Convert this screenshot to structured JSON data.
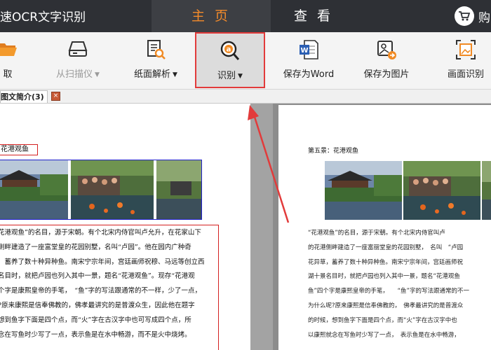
{
  "titlebar": {
    "app_title": "速OCR文字识别",
    "tabs": [
      {
        "label": "主 页",
        "active": true
      },
      {
        "label": "查 看",
        "active": false
      }
    ],
    "buy_label": "购"
  },
  "toolbar": {
    "items": [
      {
        "label": "取",
        "icon": "folder-open-icon",
        "has_dropdown": false,
        "enabled": true
      },
      {
        "label": "从扫描仪",
        "icon": "scanner-icon",
        "has_dropdown": true,
        "enabled": false
      },
      {
        "label": "纸面解析",
        "icon": "document-search-icon",
        "has_dropdown": true,
        "enabled": true
      },
      {
        "label": "识别",
        "icon": "ocr-magnifier-icon",
        "has_dropdown": true,
        "enabled": true,
        "highlighted": true
      },
      {
        "label": "保存为Word",
        "icon": "word-file-icon",
        "has_dropdown": false,
        "enabled": true
      },
      {
        "label": "保存为图片",
        "icon": "save-image-icon",
        "has_dropdown": false,
        "enabled": true
      },
      {
        "label": "画面识别",
        "icon": "screen-capture-icon",
        "has_dropdown": false,
        "enabled": true
      }
    ],
    "dropdown_glyph": "▼"
  },
  "doc_tab": {
    "label": "图文简介(3)",
    "close": "×"
  },
  "left_page": {
    "heading": "花港观鱼",
    "lines": [
      "花港观鱼”的名目，源于宋朝。有个北宋内侍官叫卢允升，在花家山下",
      "侧畔建造了一座富堂皇的花园别墅，名叫“卢园”。他在园内广种奇",
      "　蓄养了数十种异种鱼。南宋宁宗年间，宫廷画师祝穆、马远等创立西",
      "名目时，就把卢园也列入其中一景，题名“花港观鱼”。现存“花港观",
      "个字是康熙皇帝的手笔，　“鱼”字的写法跟通常的不一样，少了一点，",
      "?原来康熙是信奉佛教的，佛孝最讲究的是普渡众生，因此他在题字",
      "想到鱼字下面是四个点，而“火”字在古汉字中也可写成四个点，所",
      "念在写鱼时少写了一点，表示鱼是在水中畅游，而不是火中烧烤。"
    ]
  },
  "right_page": {
    "heading": "第五景：花港观鱼",
    "lines": [
      "“花港观鱼”的名目，源于宋朝。有个北宋内侍官叫卢",
      "的花港侧畔建造了一座富丽堂皇的花园别墅，　名叫　“卢园",
      "花异草，蓄养了数十种异种鱼。南宋宁宗年间，宫廷画师祝",
      "湖十景名目时，就把卢园也列入其中一景，题名“花港观鱼",
      "鱼”四个字是康熙皇帝的手笔，　　“鱼”字的写法跟通常的不一",
      "为什么呢?原来康熙是信奉佛教的，　佛孝最讲究的是普渡众",
      "的时候，想到鱼字下面是四个点，而“火”字在古汉字中也",
      "以康熙就念在写鱼时少写了一点，　表示鱼是在水中畅游，"
    ]
  },
  "colors": {
    "titlebar_bg": "#2e3035",
    "active_tab_text": "#f28a2b",
    "highlight_border": "#e23b3b",
    "toolbar_bg": "#f4f4f4",
    "workspace_bg": "#8c8c8c"
  }
}
